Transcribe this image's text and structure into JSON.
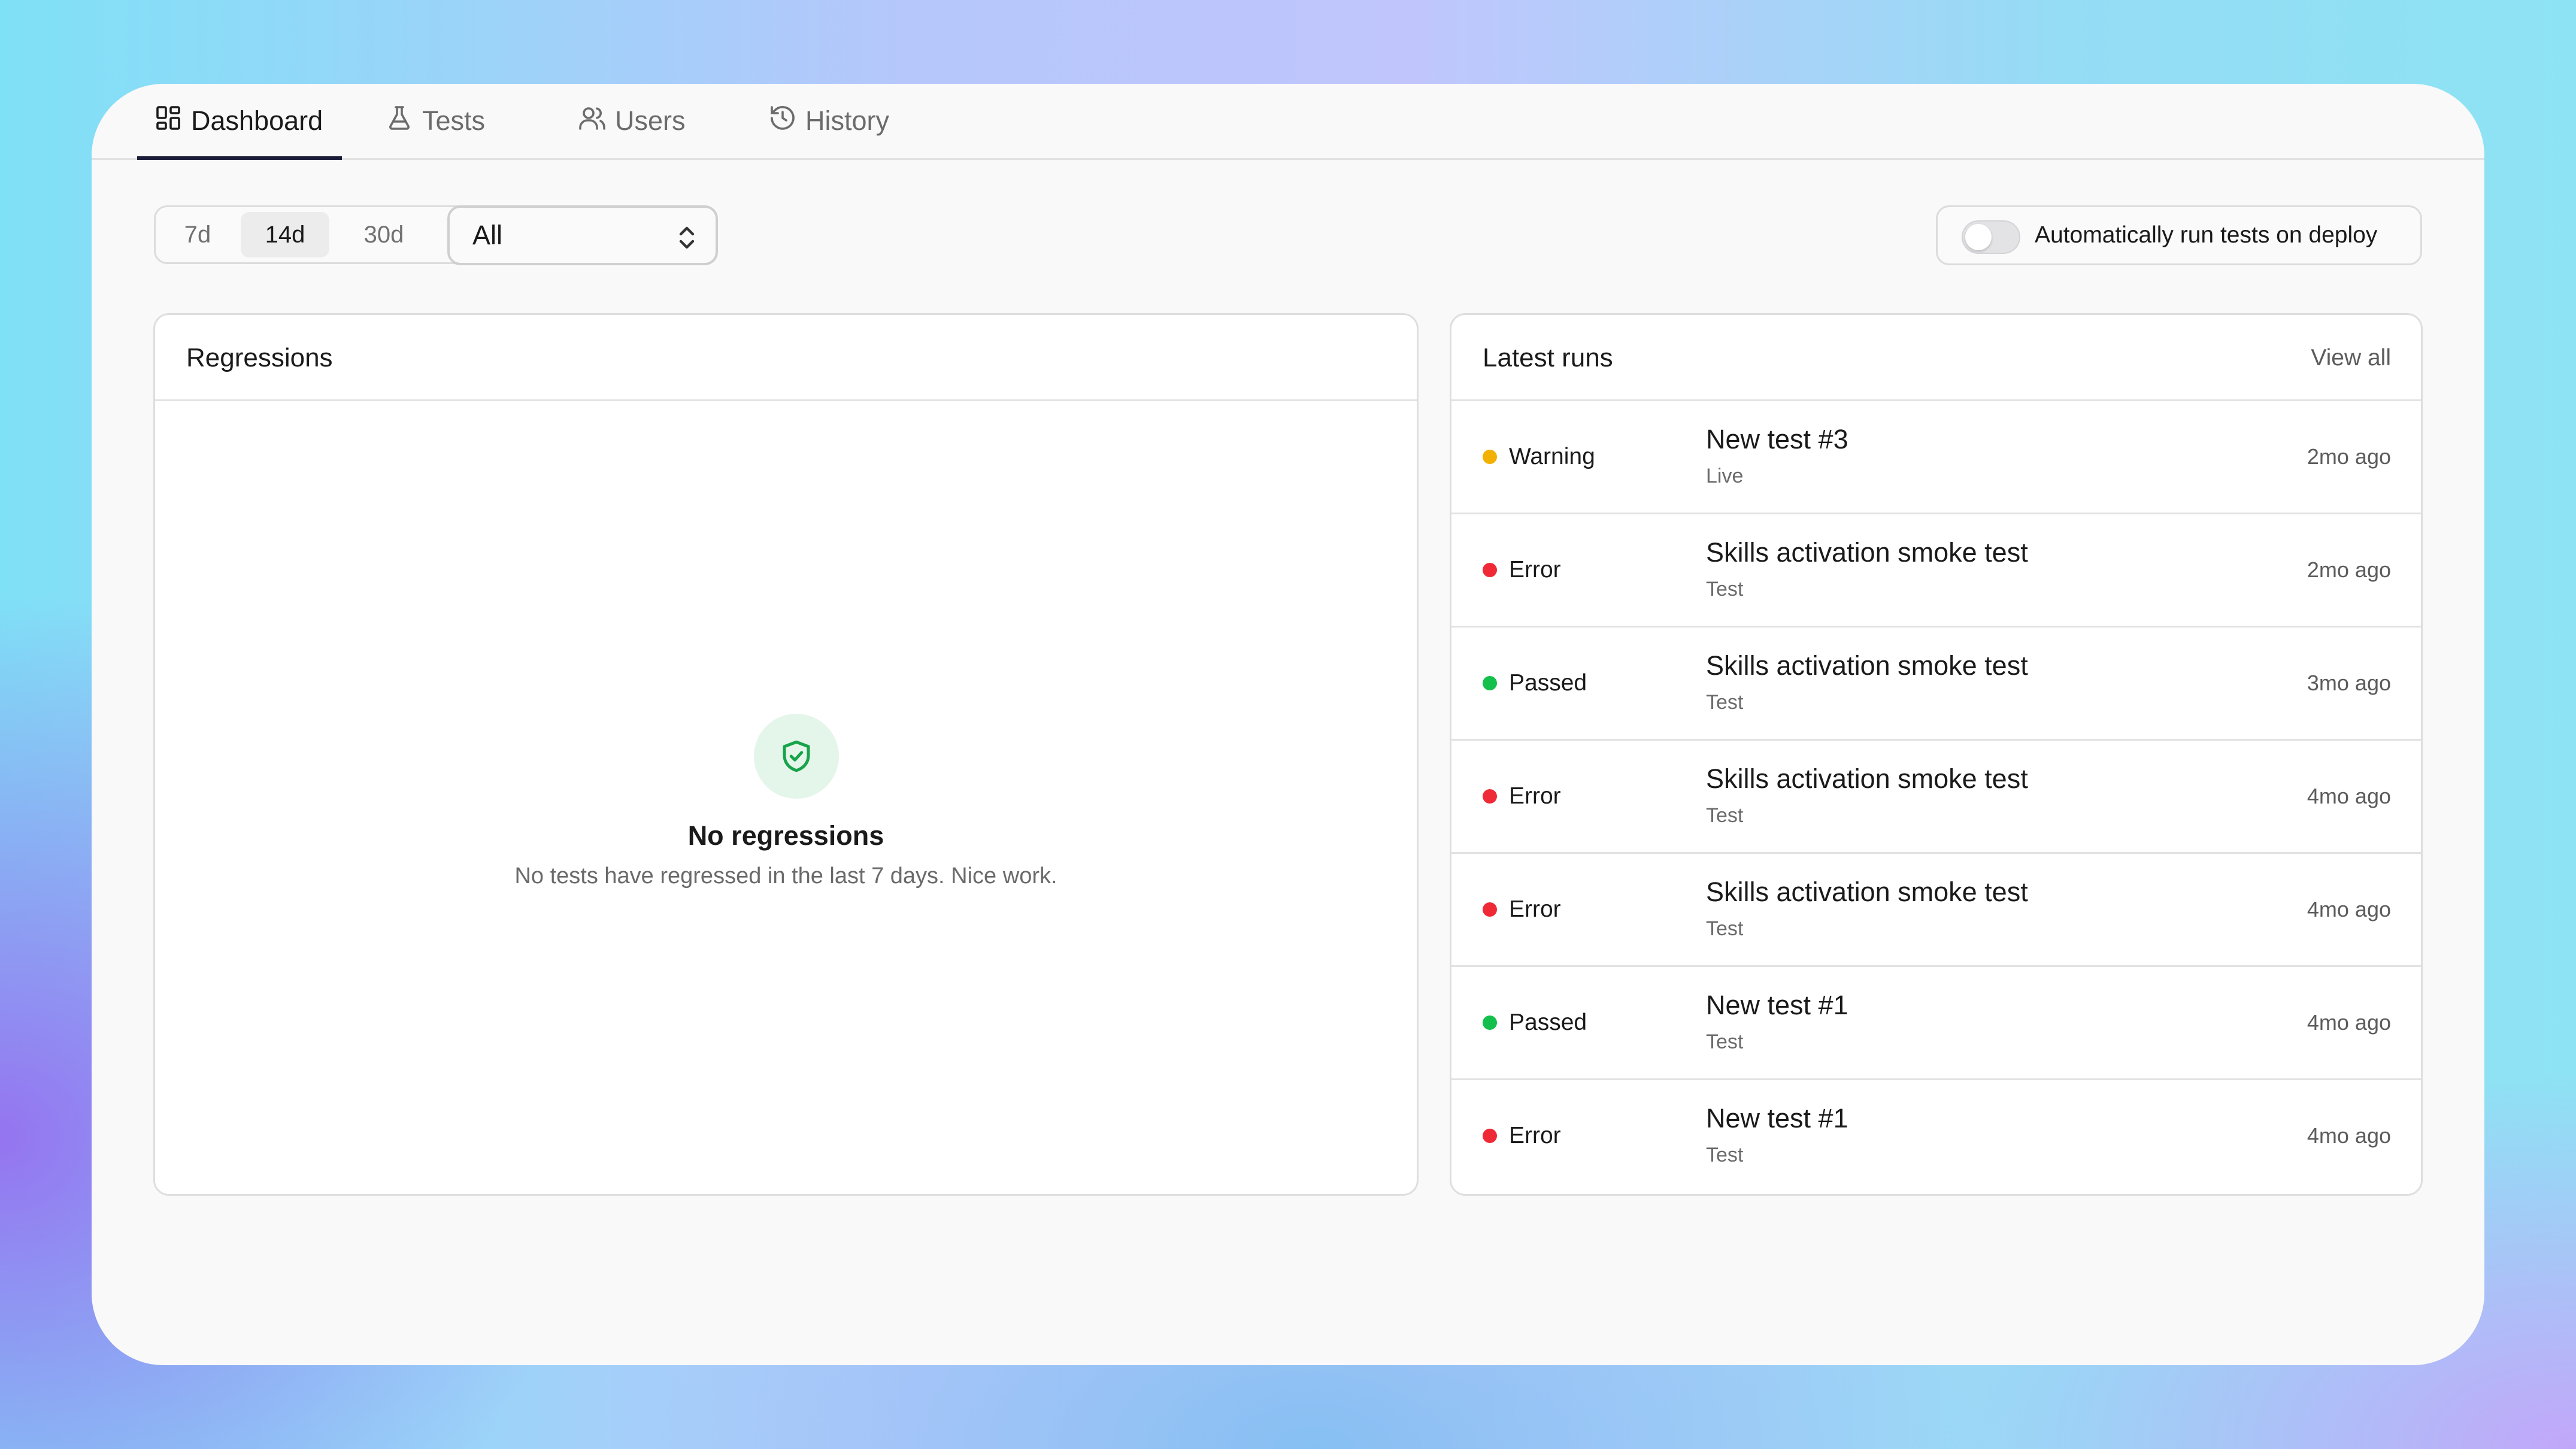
{
  "tabs": [
    {
      "label": "Dashboard",
      "icon": "dashboard-grid-icon",
      "active": true
    },
    {
      "label": "Tests",
      "icon": "flask-icon",
      "active": false
    },
    {
      "label": "Users",
      "icon": "users-icon",
      "active": false
    },
    {
      "label": "History",
      "icon": "history-icon",
      "active": false
    }
  ],
  "range": {
    "options": [
      "7d",
      "14d",
      "30d"
    ],
    "selected": "14d"
  },
  "filter": {
    "value": "All"
  },
  "auto_run": {
    "label": "Automatically run tests on deploy",
    "enabled": false
  },
  "regressions": {
    "title": "Regressions",
    "empty_title": "No regressions",
    "empty_message": "No tests have regressed in the last 7 days. Nice work."
  },
  "latest_runs": {
    "title": "Latest runs",
    "view_all": "View all",
    "items": [
      {
        "status": "Warning",
        "name": "New test #3",
        "kind": "Live",
        "time": "2mo ago"
      },
      {
        "status": "Error",
        "name": "Skills activation smoke test",
        "kind": "Test",
        "time": "2mo ago"
      },
      {
        "status": "Passed",
        "name": "Skills activation smoke test",
        "kind": "Test",
        "time": "3mo ago"
      },
      {
        "status": "Error",
        "name": "Skills activation smoke test",
        "kind": "Test",
        "time": "4mo ago"
      },
      {
        "status": "Error",
        "name": "Skills activation smoke test",
        "kind": "Test",
        "time": "4mo ago"
      },
      {
        "status": "Passed",
        "name": "New test #1",
        "kind": "Test",
        "time": "4mo ago"
      },
      {
        "status": "Error",
        "name": "New test #1",
        "kind": "Test",
        "time": "4mo ago"
      }
    ]
  },
  "colors": {
    "warning": "#f2b100",
    "error": "#ef2a36",
    "passed": "#13c04b",
    "accent": "#1c1c3a"
  }
}
